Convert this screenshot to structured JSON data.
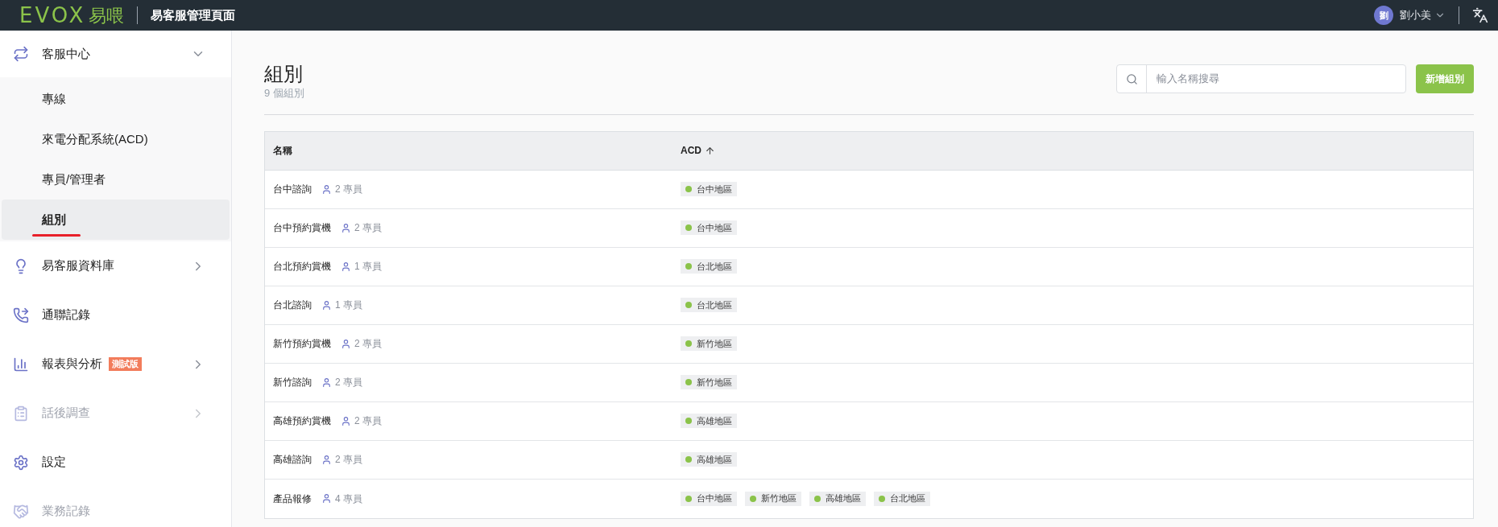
{
  "topbar": {
    "logo_latin": "EVOX",
    "logo_cjk": "易喂",
    "title": "易客服管理頁面",
    "user": {
      "avatar": "劉",
      "name": "劉小美"
    }
  },
  "sidebar": {
    "items": [
      {
        "label": "客服中心",
        "kind": "group",
        "expanded": true,
        "disabled": false,
        "children": [
          {
            "label": "專線",
            "selected": false
          },
          {
            "label": "來電分配系統(ACD)",
            "selected": false
          },
          {
            "label": "專員/管理者",
            "selected": false
          },
          {
            "label": "組別",
            "selected": true
          }
        ]
      },
      {
        "label": "易客服資料庫",
        "kind": "group",
        "expanded": false,
        "disabled": false
      },
      {
        "label": "通聯記錄",
        "kind": "link",
        "disabled": false
      },
      {
        "label": "報表與分析",
        "kind": "group",
        "expanded": false,
        "disabled": false,
        "badge": "測試版"
      },
      {
        "label": "話後調查",
        "kind": "group",
        "expanded": false,
        "disabled": true
      },
      {
        "label": "設定",
        "kind": "link",
        "disabled": false
      },
      {
        "label": "業務記錄",
        "kind": "link",
        "disabled": true
      }
    ]
  },
  "page": {
    "title": "組別",
    "subtitle": "9 個組別",
    "search": {
      "placeholder": "輸入名稱搜尋"
    },
    "add_button": "新增組別"
  },
  "table": {
    "columns": [
      {
        "label": "名稱",
        "sorted": false
      },
      {
        "label": "ACD",
        "sorted": true
      }
    ],
    "rows": [
      {
        "name": "台中諮詢",
        "members": "2 專員",
        "acd": [
          "台中地區"
        ]
      },
      {
        "name": "台中預約賞機",
        "members": "2 專員",
        "acd": [
          "台中地區"
        ]
      },
      {
        "name": "台北預約賞機",
        "members": "1 專員",
        "acd": [
          "台北地區"
        ]
      },
      {
        "name": "台北諮詢",
        "members": "1 專員",
        "acd": [
          "台北地區"
        ]
      },
      {
        "name": "新竹預約賞機",
        "members": "2 專員",
        "acd": [
          "新竹地區"
        ]
      },
      {
        "name": "新竹諮詢",
        "members": "2 專員",
        "acd": [
          "新竹地區"
        ]
      },
      {
        "name": "高雄預約賞機",
        "members": "2 專員",
        "acd": [
          "高雄地區"
        ]
      },
      {
        "name": "高雄諮詢",
        "members": "2 專員",
        "acd": [
          "高雄地區"
        ]
      },
      {
        "name": "產品報修",
        "members": "4 專員",
        "acd": [
          "台中地區",
          "新竹地區",
          "高雄地區",
          "台北地區"
        ]
      }
    ]
  }
}
